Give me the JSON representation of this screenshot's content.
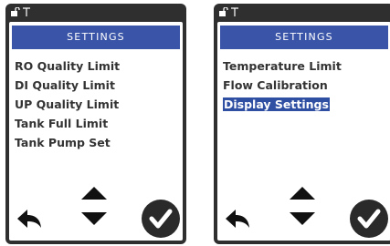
{
  "left_screen": {
    "title": "SETTINGS",
    "items": [
      {
        "label": "RO Quality Limit"
      },
      {
        "label": "DI Quality Limit"
      },
      {
        "label": "UP Quality Limit"
      },
      {
        "label": "Tank Full Limit"
      },
      {
        "label": "Tank Pump Set"
      }
    ],
    "selected_index": null
  },
  "right_screen": {
    "title": "SETTINGS",
    "items": [
      {
        "label": "Temperature Limit"
      },
      {
        "label": "Flow Calibration"
      },
      {
        "label": "Display Settings"
      }
    ],
    "selected_index": 2
  },
  "controls": {
    "icons": [
      "back-arrow-icon",
      "up-arrow-icon",
      "down-arrow-icon",
      "checkmark-icon"
    ]
  },
  "colors": {
    "header_bg": "#3a55a8",
    "highlight_bg": "#2f4fa3",
    "device_frame": "#2f2f2f",
    "text": "#333333"
  }
}
